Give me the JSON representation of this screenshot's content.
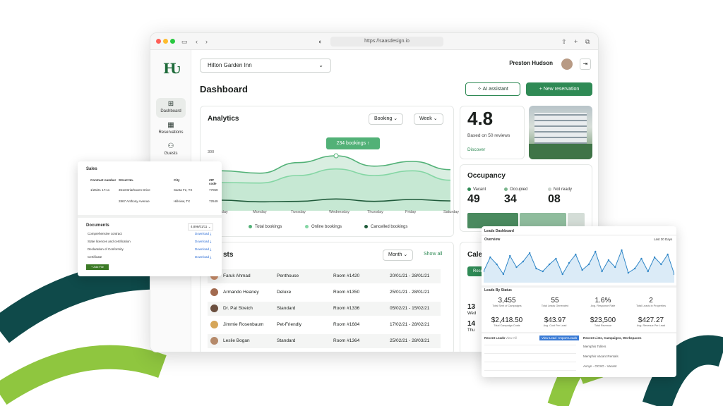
{
  "browser": {
    "url": "https://saasdesign.io"
  },
  "sidebar": {
    "items": [
      {
        "label": "Dashboard",
        "icon": "grid-icon"
      },
      {
        "label": "Reservations",
        "icon": "calendar-icon"
      },
      {
        "label": "Guests",
        "icon": "users-icon"
      }
    ]
  },
  "header": {
    "hotel": "Hilton Garden Inn",
    "user": "Preston Hudson"
  },
  "page": {
    "title": "Dashboard",
    "ai_btn": "AI assistant",
    "new_btn": "New reservation"
  },
  "analytics": {
    "title": "Analytics",
    "dd1": "Booking",
    "dd2": "Week",
    "ytick": "300",
    "tooltip": "234 bookings",
    "days": [
      "Sunday",
      "Monday",
      "Tuesday",
      "Wednesday",
      "Thursday",
      "Friday",
      "Saturday"
    ],
    "legend": [
      "Total bookings",
      "Online bookings",
      "Cancelled bookings"
    ]
  },
  "rating": {
    "value": "4.8",
    "note": "Based on 50 reviews",
    "link": "Discover"
  },
  "occupancy": {
    "title": "Occupancy",
    "labels": [
      "Vacant",
      "Occupied",
      "Not ready"
    ],
    "values": [
      "49",
      "34",
      "08"
    ]
  },
  "guests": {
    "title": "sts",
    "dd": "Month",
    "show_all": "Show all",
    "rows": [
      {
        "name": "Faruk Ahmad",
        "type": "Penthouse",
        "room": "Room #1420",
        "dates": "20/01/21 - 28/01/21"
      },
      {
        "name": "Armando Heaney",
        "type": "Deluxe",
        "room": "Room #1350",
        "dates": "25/01/21 - 28/01/21"
      },
      {
        "name": "Dr. Pat Streich",
        "type": "Standard",
        "room": "Room #1336",
        "dates": "05/02/21 - 15/02/21"
      },
      {
        "name": "Jimmie Rosenbaum",
        "type": "Pet-Friendly",
        "room": "Room #1684",
        "dates": "17/02/21 - 28/02/21"
      },
      {
        "name": "Leslie Bogan",
        "type": "Standard",
        "room": "Room #1364",
        "dates": "25/02/21 - 28/03/21"
      }
    ]
  },
  "calendar": {
    "title": "Cale",
    "btn": "Rese",
    "day1": "13",
    "wd1": "Wed",
    "day2": "14",
    "wd2": "Thu"
  },
  "sales": {
    "title": "Sales",
    "headers": [
      "Contract number",
      "Street No.",
      "City",
      "ZIP code"
    ],
    "rows": [
      [
        "1/26/21 17:11",
        "3513 Briarhaven Drive",
        "Santa Fe, TX",
        "77069"
      ],
      [
        "",
        "2867 Anthony Avenue",
        "Hillview, TX",
        "72549"
      ]
    ]
  },
  "documents": {
    "title": "Documents",
    "dd": "4,896/01/11",
    "items": [
      "Comprehensive contract",
      "State licences and certification",
      "Declaration of Conformity",
      "Certificate"
    ],
    "link": "Download",
    "btn": "+ Add File"
  },
  "leads": {
    "title": "Leads Dashboard",
    "overview": "Overview",
    "range": "Last 30 Days",
    "status_title": "Leads By Status",
    "stats": [
      {
        "v": "3,455",
        "l": "Total Sent of Campaigns"
      },
      {
        "v": "55",
        "l": "Total Leads Generated"
      },
      {
        "v": "1.6%",
        "l": "Avg. Response Rate"
      },
      {
        "v": "2",
        "l": "Total Leads In Properties"
      },
      {
        "v": "$2,418.50",
        "l": "Total Campaign Costs"
      },
      {
        "v": "$43.97",
        "l": "Avg. Cost Per Lead"
      },
      {
        "v": "$23,500",
        "l": "Total Revenue"
      },
      {
        "v": "$427.27",
        "l": "Avg. Revenue Per Lead"
      }
    ],
    "recent": "Recent Leads",
    "view_all": "View All",
    "btn1": "View Leads",
    "btn2": "Import Leads",
    "lists_title": "Recent Lists, Campaigns, Workspaces",
    "lists": [
      "Memphis Tollers",
      "Memphis Vacant Rentals",
      "Avnyn - OCSO - Vacant"
    ]
  },
  "chart_data": {
    "type": "area",
    "categories": [
      "Sunday",
      "Monday",
      "Tuesday",
      "Wednesday",
      "Thursday",
      "Friday",
      "Saturday"
    ],
    "series": [
      {
        "name": "Total bookings",
        "values": [
          170,
          160,
          205,
          234,
          190,
          210,
          175
        ]
      },
      {
        "name": "Online bookings",
        "values": [
          120,
          118,
          150,
          178,
          150,
          170,
          130
        ]
      },
      {
        "name": "Cancelled bookings",
        "values": [
          45,
          38,
          40,
          50,
          40,
          48,
          42
        ]
      }
    ],
    "ylabel": "",
    "xlabel": ""
  },
  "colors": {
    "primary": "#2f8a55",
    "dark_arc": "#0f4a4a",
    "lime_arc": "#8fc63f"
  }
}
